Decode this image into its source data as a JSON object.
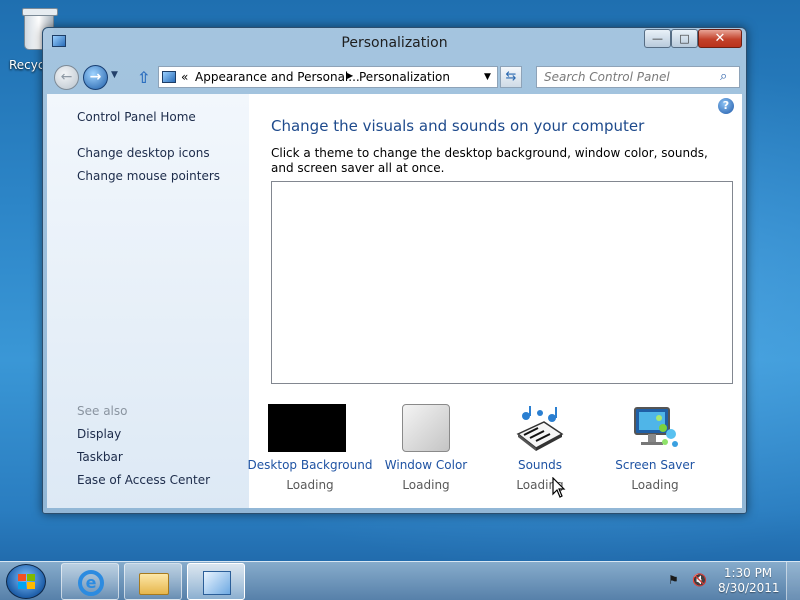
{
  "desktop": {
    "recycle_bin_label": "Recyc"
  },
  "window": {
    "title": "Personalization",
    "controls": {
      "minimize": "—",
      "maximize": "□",
      "close": "✕"
    }
  },
  "navigation": {
    "breadcrumb_prefix": "«",
    "breadcrumb": [
      "Appearance and Personal...",
      "Personalization"
    ],
    "search_placeholder": "Search Control Panel"
  },
  "sidebar": {
    "home_link": "Control Panel Home",
    "links": [
      "Change desktop icons",
      "Change mouse pointers"
    ],
    "see_also_label": "See also",
    "see_also": [
      "Display",
      "Taskbar",
      "Ease of Access Center"
    ]
  },
  "main": {
    "heading": "Change the visuals and sounds on your computer",
    "description": "Click a theme to change the desktop background, window color, sounds, and screen saver all at once.",
    "options": [
      {
        "label": "Desktop Background",
        "status": "Loading"
      },
      {
        "label": "Window Color",
        "status": "Loading"
      },
      {
        "label": "Sounds",
        "status": "Loading"
      },
      {
        "label": "Screen Saver",
        "status": "Loading"
      }
    ]
  },
  "taskbar": {
    "pinned": [
      "internet-explorer-icon",
      "windows-explorer-icon",
      "control-panel-icon"
    ],
    "clock_time": "1:30 PM",
    "clock_date": "8/30/2011"
  },
  "colors": {
    "accent": "#1f53a3",
    "heading": "#1e4a8c",
    "close_button": "#c3412a"
  }
}
